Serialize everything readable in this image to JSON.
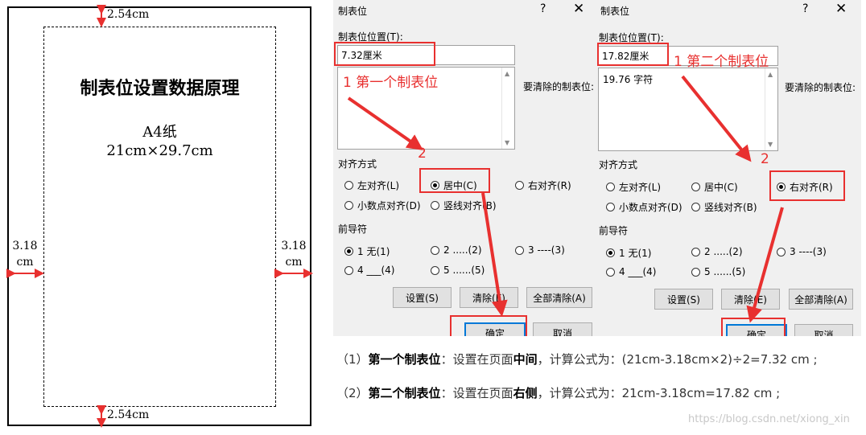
{
  "paper": {
    "title": "制表位设置数据原理",
    "size_label": "A4纸",
    "dimensions": "21cm×29.7cm",
    "top_margin": "2.54cm",
    "bottom_margin": "2.54cm",
    "left_margin_value": "3.18",
    "left_margin_unit": "cm",
    "right_margin_value": "3.18",
    "right_margin_unit": "cm"
  },
  "dialog1": {
    "title": "制表位",
    "help_glyph": "?",
    "close_glyph": "✕",
    "position_label": "制表位位置(T):",
    "position_value": "7.32厘米",
    "list_items": [],
    "clear_label": "要清除的制表位:",
    "align_label": "对齐方式",
    "align_options": [
      "左对齐(L)",
      "居中(C)",
      "右对齐(R)",
      "小数点对齐(D)",
      "竖线对齐(B)"
    ],
    "align_selected": "居中(C)",
    "leader_label": "前导符",
    "leader_options": [
      "1 无(1)",
      "2 .....(2)",
      "3 ----(3)",
      "4 ___(4)",
      "5 ......(5)"
    ],
    "leader_selected": "1 无(1)",
    "buttons": [
      "设置(S)",
      "清除(E)",
      "全部清除(A)",
      "确定",
      "取消"
    ],
    "annotation_1": "1 第一个制表位",
    "annotation_2": "2"
  },
  "dialog2": {
    "title": "制表位",
    "help_glyph": "?",
    "close_glyph": "✕",
    "position_label": "制表位位置(T):",
    "position_value": "17.82厘米",
    "list_items": [
      "19.76 字符"
    ],
    "clear_label": "要清除的制表位:",
    "align_label": "对齐方式",
    "align_options": [
      "左对齐(L)",
      "居中(C)",
      "右对齐(R)",
      "小数点对齐(D)",
      "竖线对齐(B)"
    ],
    "align_selected": "右对齐(R)",
    "leader_label": "前导符",
    "leader_options": [
      "1 无(1)",
      "2 .....(2)",
      "3 ----(3)",
      "4 ___(4)",
      "5 ......(5)"
    ],
    "leader_selected": "1 无(1)",
    "buttons": [
      "设置(S)",
      "清除(E)",
      "全部清除(A)",
      "确定",
      "取消"
    ],
    "annotation_1": "1 第二个制表位",
    "annotation_2": "2"
  },
  "notes": {
    "line1_prefix": "（1）",
    "line1_bold": "第一个制表位",
    "line1_mid": "：设置在页面",
    "line1_bold2": "中间",
    "line1_rest": "，计算公式为：(21cm-3.18cm×2)÷2=7.32 cm ;",
    "line2_prefix": "（2）",
    "line2_bold": "第二个制表位",
    "line2_mid": "：设置在页面",
    "line2_bold2": "右侧",
    "line2_rest": "，计算公式为：21cm-3.18cm=17.82 cm ;"
  },
  "watermark": "https://blog.csdn.net/xiong_xin",
  "colors": {
    "annotation_red": "#e8302f",
    "dialog_bg": "#f0f0f0",
    "default_button_border": "#0078d7"
  }
}
